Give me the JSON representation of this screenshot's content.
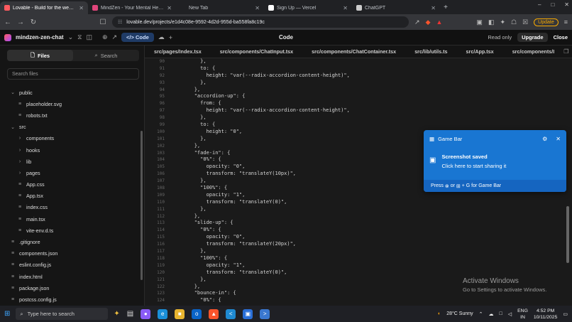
{
  "browser": {
    "tabs": [
      {
        "title": "Lovable - Build for the web 20x",
        "active": true,
        "color": "#ff5a5f"
      },
      {
        "title": "MindZen - Your Mental Health Comp",
        "active": false,
        "color": "#e0457b"
      },
      {
        "title": "New Tab",
        "active": false,
        "color": ""
      },
      {
        "title": "Sign Up — Vercel",
        "active": false,
        "color": "#ffffff"
      },
      {
        "title": "ChatGPT",
        "active": false,
        "color": "#cccccc"
      }
    ],
    "url": "lovable.dev/projects/e1d4c08e-9592-4d2d-955d-ba558fa8c19c",
    "update_label": "Update"
  },
  "app": {
    "project_name": "mindzen-zen-chat",
    "code_button": "Code",
    "center_title": "Code",
    "read_only": "Read only",
    "upgrade": "Upgrade",
    "close": "Close"
  },
  "sidebar": {
    "tab_files": "Files",
    "tab_search": "Search",
    "search_placeholder": "Search files",
    "tree": [
      {
        "label": "public",
        "type": "folder-open",
        "depth": 0
      },
      {
        "label": "placeholder.svg",
        "type": "file",
        "depth": 1
      },
      {
        "label": "robots.txt",
        "type": "file",
        "depth": 1
      },
      {
        "label": "src",
        "type": "folder-open",
        "depth": 0
      },
      {
        "label": "components",
        "type": "folder",
        "depth": 1
      },
      {
        "label": "hooks",
        "type": "folder",
        "depth": 1
      },
      {
        "label": "lib",
        "type": "folder",
        "depth": 1
      },
      {
        "label": "pages",
        "type": "folder",
        "depth": 1
      },
      {
        "label": "App.css",
        "type": "file",
        "depth": 1
      },
      {
        "label": "App.tsx",
        "type": "file",
        "depth": 1
      },
      {
        "label": "index.css",
        "type": "file",
        "depth": 1
      },
      {
        "label": "main.tsx",
        "type": "file",
        "depth": 1
      },
      {
        "label": "vite-env.d.ts",
        "type": "file",
        "depth": 1
      },
      {
        "label": ".gitignore",
        "type": "file",
        "depth": 0
      },
      {
        "label": "components.json",
        "type": "file",
        "depth": 0
      },
      {
        "label": "eslint.config.js",
        "type": "file",
        "depth": 0
      },
      {
        "label": "index.html",
        "type": "file",
        "depth": 0
      },
      {
        "label": "package.json",
        "type": "file",
        "depth": 0
      },
      {
        "label": "postcss.config.js",
        "type": "file",
        "depth": 0
      }
    ]
  },
  "editor": {
    "tabs": [
      "src/pages/Index.tsx",
      "src/components/ChatInput.tsx",
      "src/components/ChatContainer.tsx",
      "src/lib/utils.ts",
      "src/App.tsx",
      "src/components/I"
    ],
    "lines": [
      {
        "n": "90",
        "code": "          },"
      },
      {
        "n": "91",
        "code": "          to: {"
      },
      {
        "n": "92",
        "code": "            height: \"var(--radix-accordion-content-height)\","
      },
      {
        "n": "93",
        "code": "          },"
      },
      {
        "n": "94",
        "code": "        },"
      },
      {
        "n": "95",
        "code": "        \"accordion-up\": {"
      },
      {
        "n": "96",
        "code": "          from: {"
      },
      {
        "n": "97",
        "code": "            height: \"var(--radix-accordion-content-height)\","
      },
      {
        "n": "98",
        "code": "          },"
      },
      {
        "n": "99",
        "code": "          to: {"
      },
      {
        "n": "100",
        "code": "            height: \"0\","
      },
      {
        "n": "101",
        "code": "          },"
      },
      {
        "n": "102",
        "code": "        },"
      },
      {
        "n": "103",
        "code": "        \"fade-in\": {"
      },
      {
        "n": "104",
        "code": "          \"0%\": {"
      },
      {
        "n": "105",
        "code": "            opacity: \"0\","
      },
      {
        "n": "106",
        "code": "            transform: \"translateY(10px)\","
      },
      {
        "n": "107",
        "code": "          },"
      },
      {
        "n": "108",
        "code": "          \"100%\": {"
      },
      {
        "n": "109",
        "code": "            opacity: \"1\","
      },
      {
        "n": "110",
        "code": "            transform: \"translateY(0)\","
      },
      {
        "n": "111",
        "code": "          },"
      },
      {
        "n": "112",
        "code": "        },"
      },
      {
        "n": "113",
        "code": "        \"slide-up\": {"
      },
      {
        "n": "114",
        "code": "          \"0%\": {"
      },
      {
        "n": "115",
        "code": "            opacity: \"0\","
      },
      {
        "n": "116",
        "code": "            transform: \"translateY(20px)\","
      },
      {
        "n": "117",
        "code": "          },"
      },
      {
        "n": "118",
        "code": "          \"100%\": {"
      },
      {
        "n": "119",
        "code": "            opacity: \"1\","
      },
      {
        "n": "120",
        "code": "            transform: \"translateY(0)\","
      },
      {
        "n": "121",
        "code": "          },"
      },
      {
        "n": "122",
        "code": "        },"
      },
      {
        "n": "123",
        "code": "        \"bounce-in\": {"
      },
      {
        "n": "124",
        "code": "          \"0%\": {"
      }
    ]
  },
  "toast": {
    "app": "Game Bar",
    "title": "Screenshot saved",
    "subtitle": "Click here to start sharing it",
    "footer_prefix": "Press",
    "footer_or": "or",
    "footer_suffix": "+ G for Game Bar"
  },
  "watermark": {
    "line1": "Activate Windows",
    "line2": "Go to Settings to activate Windows."
  },
  "taskbar": {
    "search_placeholder": "Type here to search",
    "weather": "28°C  Sunny",
    "lang": "ENG",
    "region": "IN",
    "time": "4:52 PM",
    "date": "10/11/2025"
  }
}
